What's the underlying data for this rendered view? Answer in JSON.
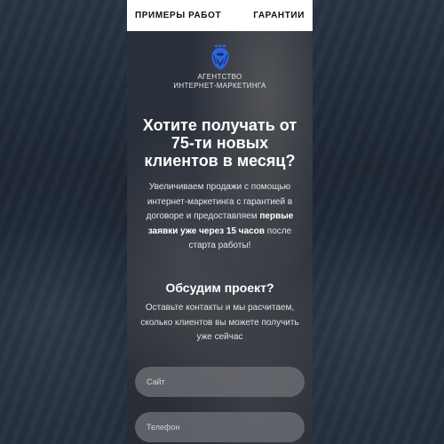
{
  "nav": {
    "works_label": "ПРИМЕРЫ РАБОТ",
    "guarantees_label": "ГАРАНТИИ"
  },
  "logo": {
    "line1": "АГЕНТСТВО",
    "line2": "ИНТЕРНЕТ-МАРКЕТИНГА",
    "accent_color": "#2f63d6"
  },
  "hero": {
    "headline": "Хотите получать от 75-ти новых клиентов в месяц?",
    "lead_part1": "Увеличиваем продажи с помощью интернет-маркетинга с гарантией в договоре и предоставляем ",
    "lead_bold": "первые заявки уже через 15 часов",
    "lead_part2": " после старта работы!"
  },
  "form": {
    "title": "Обсудим проект?",
    "description": "Оставьте контакты и мы расчитаем, сколько клиентов вы можете получить уже сейчас",
    "site_placeholder": "Сайт",
    "phone_placeholder": "Телефон"
  }
}
